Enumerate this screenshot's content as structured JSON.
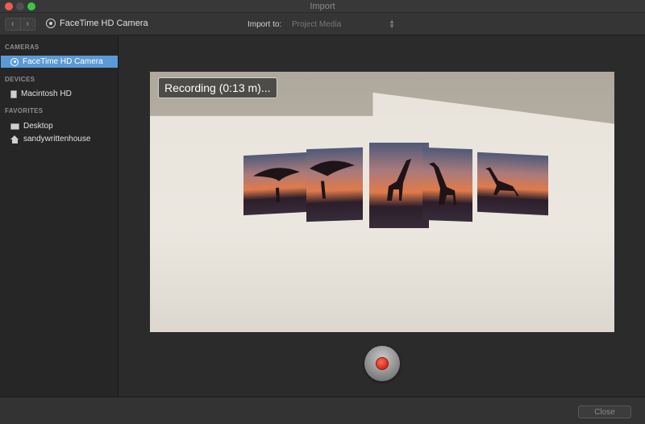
{
  "window": {
    "title": "Import"
  },
  "toolbar": {
    "back_icon": "chevron-left-icon",
    "forward_icon": "chevron-right-icon",
    "source_label": "FaceTime HD Camera",
    "import_to_label": "Import to:",
    "import_to_value": "Project Media"
  },
  "sidebar": {
    "sections": [
      {
        "header": "CAMERAS",
        "items": [
          {
            "label": "FaceTime HD Camera",
            "icon": "camera-icon",
            "selected": true
          }
        ]
      },
      {
        "header": "DEVICES",
        "items": [
          {
            "label": "Macintosh HD",
            "icon": "disk-icon"
          }
        ]
      },
      {
        "header": "FAVORITES",
        "items": [
          {
            "label": "Desktop",
            "icon": "desktop-icon"
          },
          {
            "label": "sandywrittenhouse",
            "icon": "home-icon"
          }
        ]
      }
    ]
  },
  "preview": {
    "status": "Recording (0:13 m)..."
  },
  "footer": {
    "close_label": "Close"
  },
  "colors": {
    "selection": "#5b9ad6",
    "record": "#d8281a"
  }
}
